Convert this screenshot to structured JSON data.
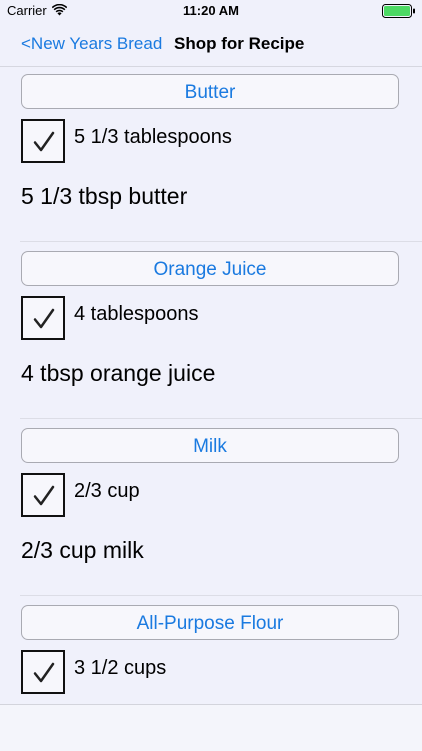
{
  "status_bar": {
    "carrier": "Carrier",
    "time": "11:20 AM",
    "wifi_icon": "wifi-icon",
    "battery_icon": "battery-icon"
  },
  "nav": {
    "back_label": "<New Years Bread",
    "title": "Shop for Recipe"
  },
  "colors": {
    "accent": "#1a7ae0",
    "background": "#f0f1fb",
    "battery": "#4cd964"
  },
  "ingredients": [
    {
      "name": "Butter",
      "amount": "5 1/3 tablespoons",
      "summary": "5 1/3 tbsp butter",
      "checked": true
    },
    {
      "name": "Orange Juice",
      "amount": "4 tablespoons",
      "summary": "4 tbsp orange juice",
      "checked": true
    },
    {
      "name": "Milk",
      "amount": "2/3 cup",
      "summary": "2/3 cup milk",
      "checked": true
    },
    {
      "name": "All-Purpose Flour",
      "amount": "3 1/2 cups",
      "summary": "",
      "checked": true
    }
  ]
}
